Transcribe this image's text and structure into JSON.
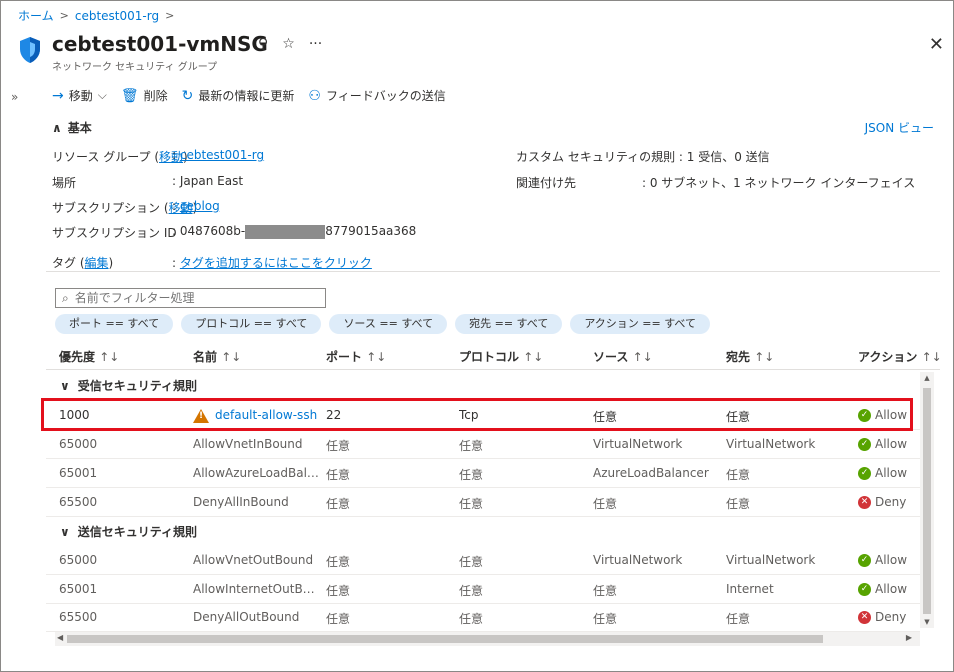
{
  "breadcrumb": {
    "home": "ホーム",
    "rg": "cebtest001-rg"
  },
  "header": {
    "title": "cebtest001-vmNSG",
    "subtitle": "ネットワーク セキュリティ グループ"
  },
  "toolbar": {
    "move": "移動",
    "delete": "削除",
    "refresh": "最新の情報に更新",
    "feedback": "フィードバックの送信"
  },
  "essentials": {
    "heading": "基本",
    "json_view": "JSON ビュー",
    "resource_group_label": "リソース グループ",
    "move_link": "移動",
    "resource_group_value": "cebtest001-rg",
    "location_label": "場所",
    "location_value": "Japan East",
    "subscription_label": "サブスクリプション",
    "subscription_value": "ceblog",
    "subscription_id_label": "サブスクリプション ID",
    "subscription_id_prefix": "0487608b-",
    "subscription_id_suffix": "8779015aa368",
    "tags_label": "タグ",
    "edit_link": "編集",
    "tags_value": "タグを追加するにはここをクリック",
    "custom_rules_label": "カスタム セキュリティの規則",
    "custom_rules_value": "1 受信、0 送信",
    "associated_label": "関連付け先",
    "associated_value": "0 サブネット、1 ネットワーク インターフェイス"
  },
  "filter": {
    "placeholder": "名前でフィルター処理",
    "pills": [
      "ポート == すべて",
      "プロトコル == すべて",
      "ソース == すべて",
      "宛先 == すべて",
      "アクション == すべて"
    ]
  },
  "columns": [
    "優先度",
    "名前",
    "ポート",
    "プロトコル",
    "ソース",
    "宛先",
    "アクション"
  ],
  "inbound": {
    "label": "受信セキュリティ規則",
    "rows": [
      [
        "1000",
        "default-allow-ssh",
        "22",
        "Tcp",
        "任意",
        "任意",
        "Allow"
      ],
      [
        "65000",
        "AllowVnetInBound",
        "任意",
        "任意",
        "VirtualNetwork",
        "VirtualNetwork",
        "Allow"
      ],
      [
        "65001",
        "AllowAzureLoadBalan...",
        "任意",
        "任意",
        "AzureLoadBalancer",
        "任意",
        "Allow"
      ],
      [
        "65500",
        "DenyAllInBound",
        "任意",
        "任意",
        "任意",
        "任意",
        "Deny"
      ]
    ]
  },
  "outbound": {
    "label": "送信セキュリティ規則",
    "rows": [
      [
        "65000",
        "AllowVnetOutBound",
        "任意",
        "任意",
        "VirtualNetwork",
        "VirtualNetwork",
        "Allow"
      ],
      [
        "65001",
        "AllowInternetOutBound",
        "任意",
        "任意",
        "任意",
        "Internet",
        "Allow"
      ],
      [
        "65500",
        "DenyAllOutBound",
        "任意",
        "任意",
        "任意",
        "任意",
        "Deny"
      ]
    ]
  },
  "colors": {
    "accent": "#0078d4",
    "allow": "#57a300",
    "deny": "#d13438",
    "warning": "#d47500",
    "highlight": "#e3101c"
  }
}
